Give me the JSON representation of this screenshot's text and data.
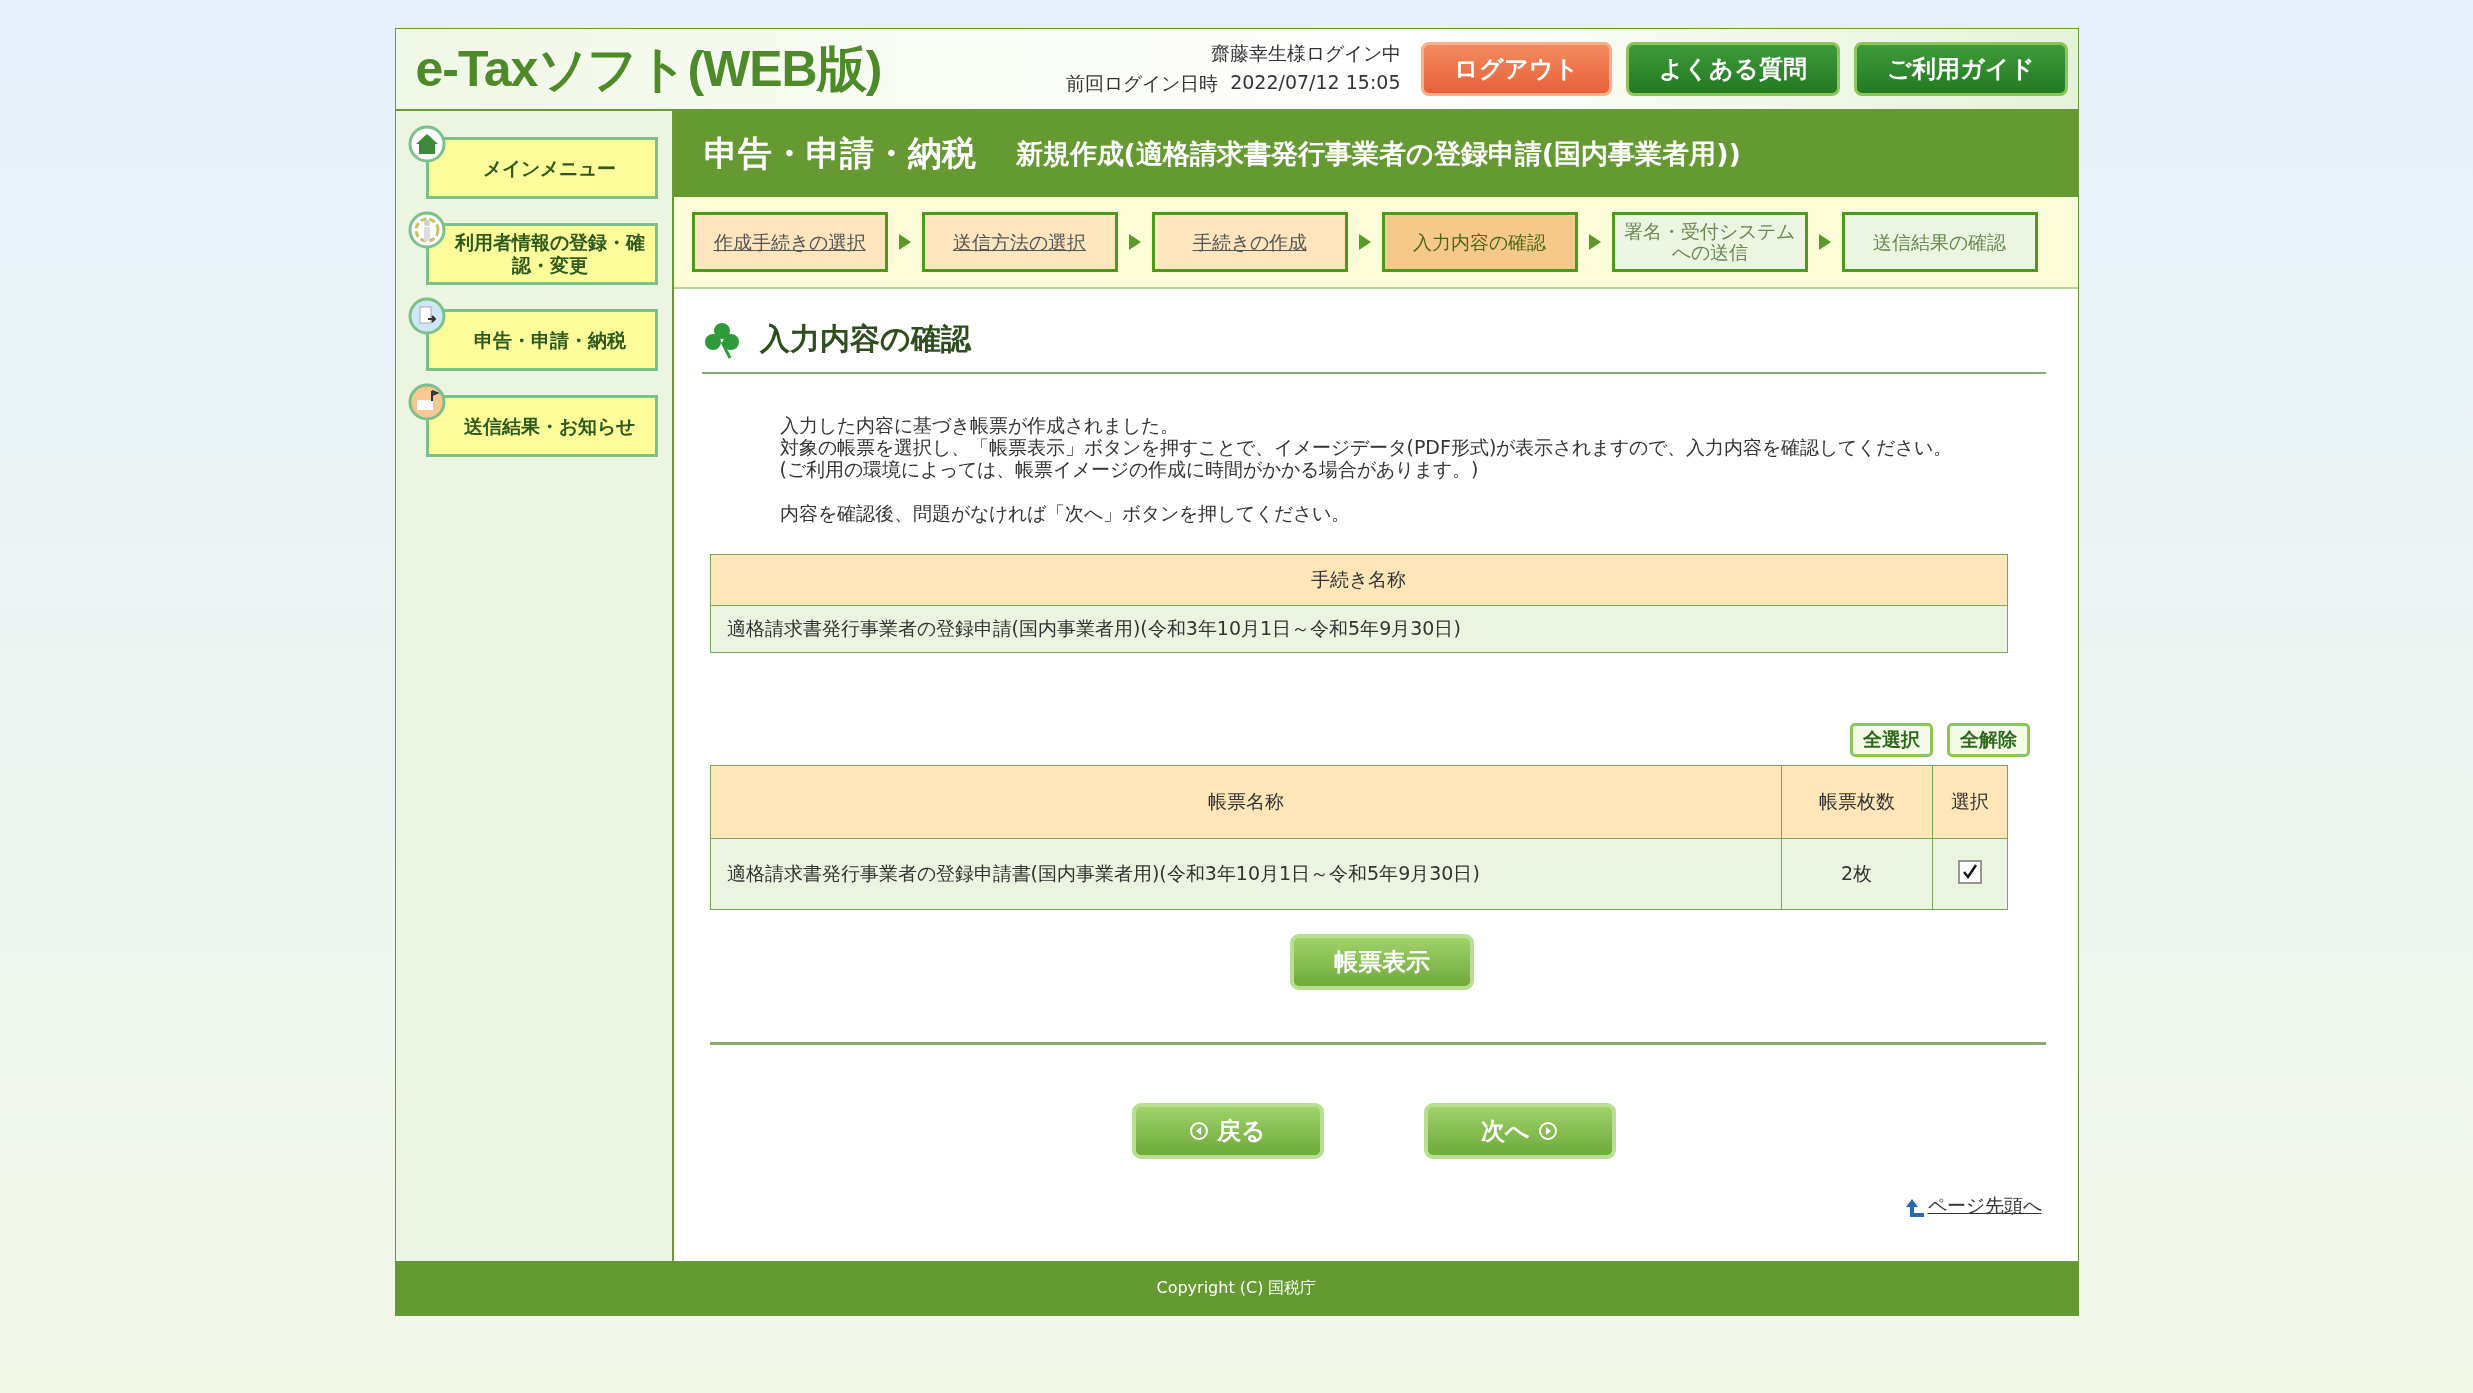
{
  "header": {
    "logo": "e-Taxソフト(WEB版)",
    "user": "齋藤幸生様ログイン中",
    "last_login_label": "前回ログイン日時",
    "last_login": "2022/07/12 15:05",
    "buttons": [
      {
        "label": "ログアウト",
        "kind": "logout"
      },
      {
        "label": "よくある質問",
        "kind": "link"
      },
      {
        "label": "ご利用ガイド",
        "kind": "link"
      }
    ]
  },
  "sidebar": {
    "items": [
      {
        "label": "メインメニュー",
        "kind": "home"
      },
      {
        "label": "利用者情報の登録・確認・変更",
        "kind": "user"
      },
      {
        "label": "申告・申請・納税",
        "kind": "doc"
      },
      {
        "label": "送信結果・お知らせ",
        "kind": "mail"
      }
    ]
  },
  "title_bar": {
    "title": "申告・申請・納税",
    "subtitle": "新規作成(適格請求書発行事業者の登録申請(国内事業者用))"
  },
  "steps": [
    {
      "label": "作成手続きの選択",
      "done": true,
      "selected": false
    },
    {
      "label": "送信方法の選択",
      "done": true,
      "selected": false
    },
    {
      "label": "手続きの作成",
      "done": true,
      "selected": false
    },
    {
      "label": "入力内容の確認",
      "done": false,
      "selected": true
    },
    {
      "label": "署名・受付システムへの送信",
      "done": false,
      "selected": false
    },
    {
      "label": "送信結果の確認",
      "done": false,
      "selected": false
    }
  ],
  "section_title": "入力内容の確認",
  "notes": [
    "入力した内容に基づき帳票が作成されました。",
    "対象の帳票を選択し、「帳票表示」ボタンを押すことで、イメージデータ(PDF形式)が表示されますので、入力内容を確認してください。",
    "(ご利用の環境によっては、帳票イメージの作成に時間がかかる場合があります。)",
    "内容を確認後、問題がなければ「次へ」ボタンを押してください。"
  ],
  "procedure_table": {
    "header": "手続き名称",
    "value": "適格請求書発行事業者の登録申請(国内事業者用)(令和3年10月1日～令和5年9月30日)"
  },
  "select_buttons": [
    "全選択",
    "全解除"
  ],
  "form_table": {
    "columns": [
      "帳票名称",
      "帳票枚数",
      "選択"
    ],
    "rows": [
      {
        "name": "適格請求書発行事業者の登録申請書(国内事業者用)(令和3年10月1日～令和5年9月30日)",
        "count": "2枚",
        "checked": true
      }
    ]
  },
  "view_button": "帳票表示",
  "nav_buttons": [
    {
      "label": "戻る",
      "kind": "back"
    },
    {
      "label": "次へ",
      "kind": "next"
    }
  ],
  "page_top": "ページ先頭へ",
  "footer": "Copyright (C) 国税庁"
}
